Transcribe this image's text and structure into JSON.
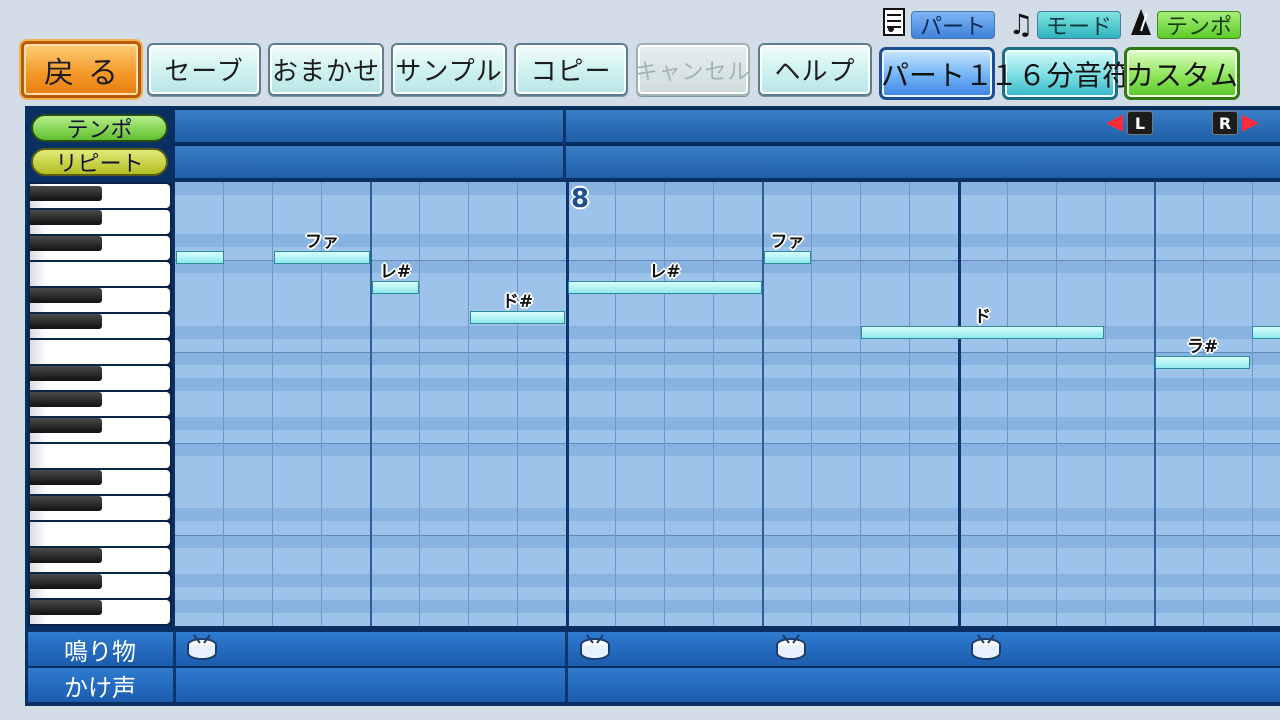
{
  "toolbar": {
    "back_label": "戻る",
    "save_label": "セーブ",
    "omakase_label": "おまかせ",
    "sample_label": "サンプル",
    "copy_label": "コピー",
    "cancel_label": "キャンセル",
    "help_label": "ヘルプ"
  },
  "selectors": {
    "part": {
      "tag": "パート",
      "value": "パート１"
    },
    "mode": {
      "tag": "モード",
      "value": "１６分音符"
    },
    "tempo": {
      "tag": "テンポ",
      "value": "カスタム"
    }
  },
  "rows": {
    "tempo_label": "テンポ",
    "repeat_label": "リピート",
    "percussion_label": "鳴り物",
    "chant_label": "かけ声"
  },
  "scroll": {
    "left_key": "L",
    "right_key": "R"
  },
  "measure_number": "8",
  "notes": [
    {
      "label": ""
    },
    {
      "label": "ファ"
    },
    {
      "label": "レ#"
    },
    {
      "label": "ド#"
    },
    {
      "label": "レ#"
    },
    {
      "label": "ファ"
    },
    {
      "label": "ド"
    },
    {
      "label": "ラ#"
    },
    {
      "label": ""
    }
  ],
  "colors": {
    "background": "#d3dde8",
    "back_button": "#f59a2b",
    "grid": "#9ec3ea",
    "note": "#bff4f5"
  },
  "icons": {
    "part": "score-icon",
    "mode": "music-note-icon",
    "tempo": "metronome-icon",
    "percussion": "drum-icon"
  }
}
